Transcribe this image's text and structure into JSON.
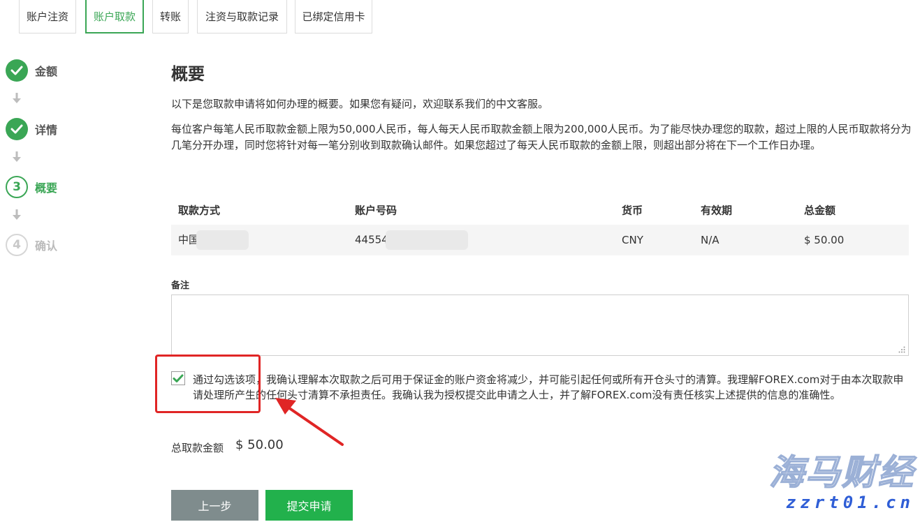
{
  "tabs": [
    {
      "label": "账户注资",
      "active": false
    },
    {
      "label": "账户取款",
      "active": true
    },
    {
      "label": "转账",
      "active": false
    },
    {
      "label": "注资与取款记录",
      "active": false
    },
    {
      "label": "已绑定信用卡",
      "active": false
    }
  ],
  "steps": [
    {
      "number": "1",
      "label": "金额",
      "state": "done"
    },
    {
      "number": "2",
      "label": "详情",
      "state": "done"
    },
    {
      "number": "3",
      "label": "概要",
      "state": "current"
    },
    {
      "number": "4",
      "label": "确认",
      "state": "todo"
    }
  ],
  "summary": {
    "title": "概要",
    "intro": "以下是您取款申请将如何办理的概要。如果您有疑问，欢迎联系我们的中文客服。",
    "notice": "每位客户每笔人民币取款金额上限为50,000人民币，每人每天人民币取款金额上限为200,000人民币。为了能尽快办理您的取款，超过上限的人民币取款将分为几笔分开办理，同时您将针对每一笔分别收到取款确认邮件。如果您超过了每天人民币取款的金额上限，则超出部分将在下一个工作日办理。"
  },
  "table": {
    "headers": [
      "取款方式",
      "账户号码",
      "货币",
      "有效期",
      "总金额"
    ],
    "row": {
      "method": "中国",
      "account": "44554",
      "currency": "CNY",
      "expiry": "N/A",
      "amount": "$ 50.00"
    }
  },
  "remarks": {
    "label": "备注",
    "value": ""
  },
  "consent": {
    "checked": true,
    "text": "通过勾选该项，我确认理解本次取款之后可用于保证金的账户资金将减少，并可能引起任何或所有开仓头寸的清算。我理解FOREX.com对于由本次取款申请处理所产生的任何头寸清算不承担责任。我确认我为授权提交此申请之人士，并了解FOREX.com没有责任核实上述提供的信息的准确性。"
  },
  "total": {
    "label": "总取款金额",
    "value": "$ 50.00"
  },
  "buttons": {
    "prev": "上一步",
    "submit": "提交申请"
  },
  "watermark": {
    "title": "海马财经",
    "domain": "zzrt01.cn"
  },
  "colors": {
    "accent": "#3aa655",
    "submit": "#22b14c",
    "prev": "#7f8c8d",
    "annotation": "#e02525"
  }
}
